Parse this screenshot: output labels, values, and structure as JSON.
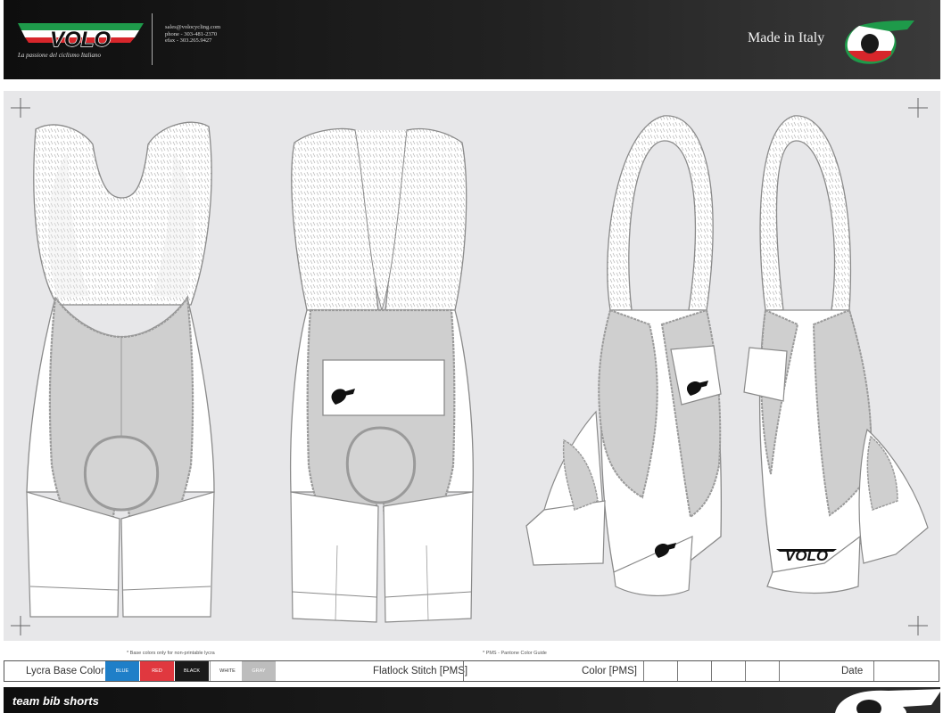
{
  "header": {
    "logo_text": "VOLO",
    "tagline": "La passione del ciclismo Italiano",
    "contact": {
      "email": "sales@volocycling.com",
      "phone": "phone - 303-481-2370",
      "efax": "efax - 303.265.9427"
    },
    "made_in": "Made in Italy"
  },
  "artwork": {
    "logo_text": "VOLO"
  },
  "notes": {
    "base_colors": "* Base colors only for non-printable lycra",
    "pms_guide": "* PMS - Pantone Color Guide"
  },
  "spec": {
    "lycra_label": "Lycra Base Color",
    "swatches": [
      {
        "label": "BLUE",
        "color": "#1f7fc8",
        "text": "#ffffff"
      },
      {
        "label": "RED",
        "color": "#e0383f",
        "text": "#ffffff"
      },
      {
        "label": "BLACK",
        "color": "#1a1a1a",
        "text": "#ffffff"
      },
      {
        "label": "WHITE",
        "color": "#ffffff",
        "text": "#333333"
      },
      {
        "label": "GRAY",
        "color": "#bdbdbd",
        "text": "#ffffff"
      }
    ],
    "flatlock_label": "Flatlock Stitch [PMS]",
    "color_label": "Color [PMS]",
    "date_label": "Date"
  },
  "footer": {
    "title": "team bib shorts"
  },
  "colors": {
    "italy_green": "#1e9a4a",
    "italy_red": "#d7262b",
    "panel_gray": "#cfcfcf",
    "seam_gray": "#9a9a9a"
  }
}
